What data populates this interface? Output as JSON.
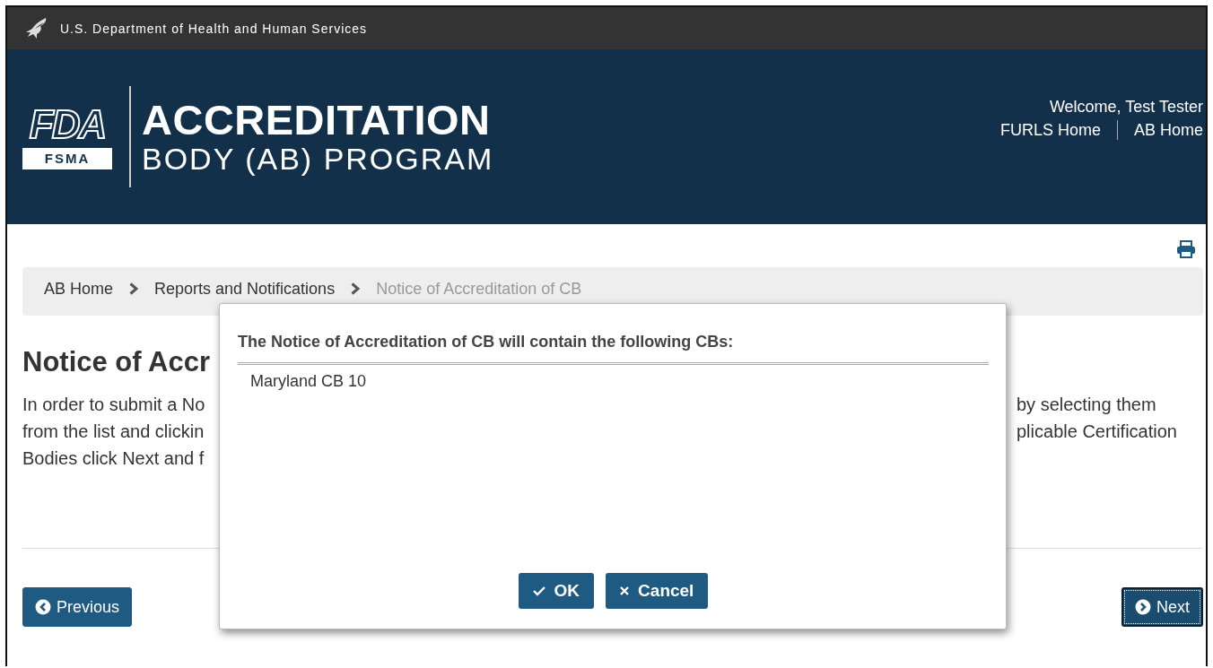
{
  "agency_bar": {
    "title": "U.S. Department of Health and Human Services"
  },
  "header": {
    "logo_text": "FDA",
    "logo_badge": "FSMA",
    "title_line_1": "ACCREDITATION",
    "title_line_2": "BODY (AB) PROGRAM",
    "welcome": "Welcome, Test Tester",
    "links": [
      "FURLS Home",
      "AB Home"
    ]
  },
  "breadcrumb": [
    {
      "label": "AB Home",
      "current": false
    },
    {
      "label": "Reports and Notifications",
      "current": false
    },
    {
      "label": "Notice of Accreditation of CB",
      "current": true
    }
  ],
  "page": {
    "heading": "Notice of Accr",
    "paragraph_lines": [
      {
        "left": "In order to submit a No",
        "right": "by selecting them"
      },
      {
        "left": "from the list and clickin",
        "right": "plicable Certification"
      },
      {
        "left": "Bodies click Next and f"
      }
    ]
  },
  "nav_buttons": [
    {
      "kind": "previous",
      "label": "Previous",
      "focused": false
    },
    {
      "kind": "next",
      "label": "Next",
      "focused": true
    }
  ],
  "dialog": {
    "title": "The Notice of Accreditation of CB will contain the following CBs:",
    "items": [
      "Maryland CB 10"
    ],
    "buttons": [
      {
        "kind": "ok",
        "label": "OK"
      },
      {
        "kind": "cancel",
        "label": "Cancel"
      }
    ]
  }
}
